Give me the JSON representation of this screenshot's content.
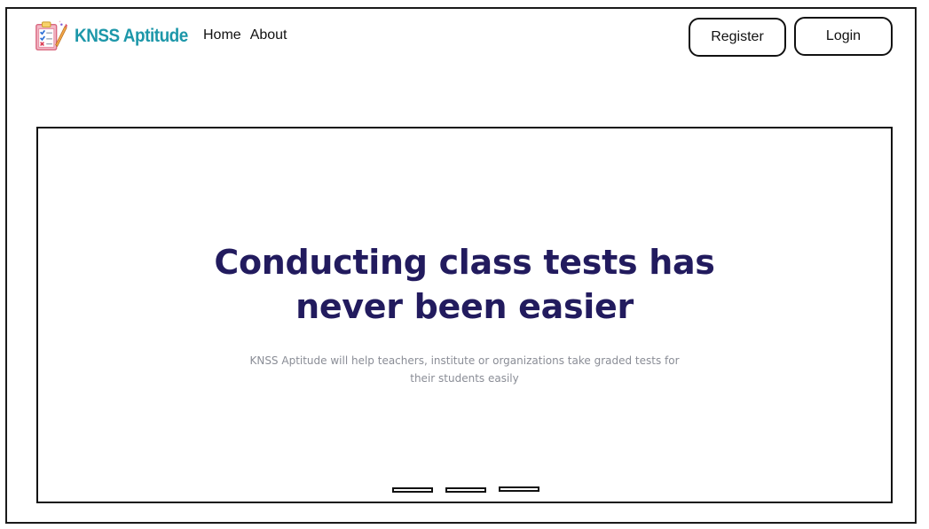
{
  "header": {
    "brand_name": "KNSS Aptitude",
    "logo_icon": "clipboard-checklist-icon",
    "nav": [
      {
        "label": "Home"
      },
      {
        "label": "About"
      }
    ],
    "register_label": "Register",
    "login_label": "Login"
  },
  "hero": {
    "title": "Conducting class tests has never been easier",
    "subtitle": "KNSS Aptitude will help teachers, institute or organizations take graded tests for their students easily",
    "slide_count": 3
  },
  "colors": {
    "brand": "#1d97a9",
    "title": "#221b5e",
    "subtitle": "#8a8d96"
  }
}
